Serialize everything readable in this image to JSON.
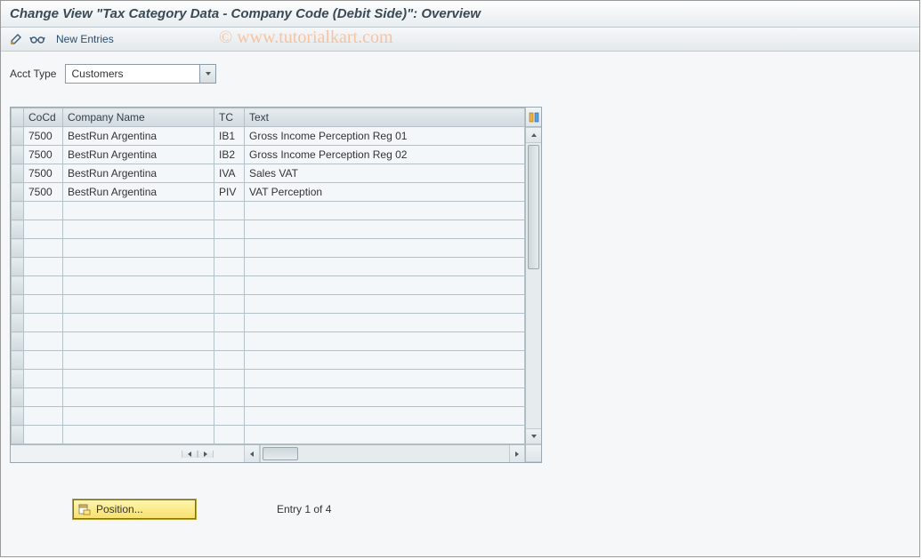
{
  "title": "Change View \"Tax Category Data - Company Code (Debit Side)\": Overview",
  "toolbar": {
    "new_entries_label": "New Entries"
  },
  "form": {
    "acct_type_label": "Acct Type",
    "acct_type_value": "Customers"
  },
  "table": {
    "headers": {
      "cocd": "CoCd",
      "company_name": "Company Name",
      "tc": "TC",
      "text": "Text"
    },
    "rows": [
      {
        "cocd": "7500",
        "company_name": "BestRun Argentina",
        "tc": "IB1",
        "text": "Gross Income Perception Reg 01"
      },
      {
        "cocd": "7500",
        "company_name": "BestRun Argentina",
        "tc": "IB2",
        "text": "Gross Income Perception Reg 02"
      },
      {
        "cocd": "7500",
        "company_name": "BestRun Argentina",
        "tc": "IVA",
        "text": "Sales VAT"
      },
      {
        "cocd": "7500",
        "company_name": "BestRun Argentina",
        "tc": "PIV",
        "text": "VAT Perception"
      }
    ]
  },
  "footer": {
    "position_label": "Position...",
    "entry_text": "Entry 1 of 4"
  },
  "watermark": "© www.tutorialkart.com"
}
